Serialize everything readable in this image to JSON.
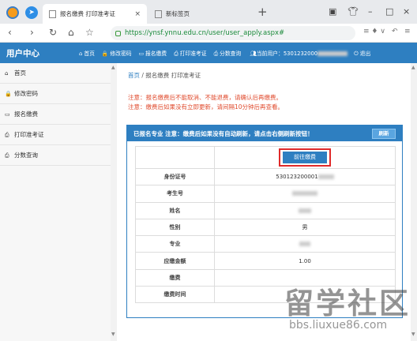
{
  "browser": {
    "active_tab_title": "报名缴费 打印准考证",
    "inactive_tab_title": "新标签页",
    "url": "https://ynsf.ynnu.edu.cn/user/user_apply.aspx#",
    "new_tab_symbol": "+",
    "close_symbol": "×"
  },
  "site": {
    "title": "用户中心",
    "nav": [
      {
        "icon": "home-icon",
        "glyph": "⌂",
        "label": "首页"
      },
      {
        "icon": "lock-icon",
        "glyph": "🔒",
        "label": "修改密码"
      },
      {
        "icon": "card-icon",
        "glyph": "▭",
        "label": "报名缴费"
      },
      {
        "icon": "print-icon",
        "glyph": "⎙",
        "label": "打印准考证"
      },
      {
        "icon": "print-icon",
        "glyph": "⎙",
        "label": "分数查询"
      }
    ],
    "current_user_label": "当前用户：5301232000",
    "logout_label": "退出"
  },
  "sidebar": {
    "items": [
      {
        "glyph": "⌂",
        "label": "首页"
      },
      {
        "glyph": "🔒",
        "label": "修改密码"
      },
      {
        "glyph": "▭",
        "label": "报名缴费"
      },
      {
        "glyph": "⎙",
        "label": "打印准考证"
      },
      {
        "glyph": "⎙",
        "label": "分数查询"
      }
    ]
  },
  "main": {
    "breadcrumb_home": "首页",
    "breadcrumb_rest": " / 报名缴费 打印准考证",
    "notice1": "注意：报名缴费后不能取消、不能退费，请确认后再缴费。",
    "notice2": "注意：缴费后如果没有立即更新，请间隔10分钟后再查看。",
    "panel_title": "已报名专业 注意：缴费后如果没有自动刷新，请点击右侧刷新按钮！",
    "refresh_label": "刷新",
    "pay_button_label": "前往缴费",
    "rows": [
      {
        "label": "身份证号",
        "value": "530123200001"
      },
      {
        "label": "考生号",
        "value": ""
      },
      {
        "label": "姓名",
        "value": ""
      },
      {
        "label": "性别",
        "value": "男"
      },
      {
        "label": "专业",
        "value": ""
      },
      {
        "label": "应缴金额",
        "value": "1.00"
      },
      {
        "label": "缴费",
        "value": ""
      },
      {
        "label": "缴费时间",
        "value": ""
      }
    ]
  },
  "watermark": {
    "big": "留学社区",
    "small": "bbs.liuxue86.com"
  },
  "colors": {
    "brand": "#2e7fc1",
    "notice": "#e04b2e",
    "highlight_border": "#e02a2a"
  }
}
